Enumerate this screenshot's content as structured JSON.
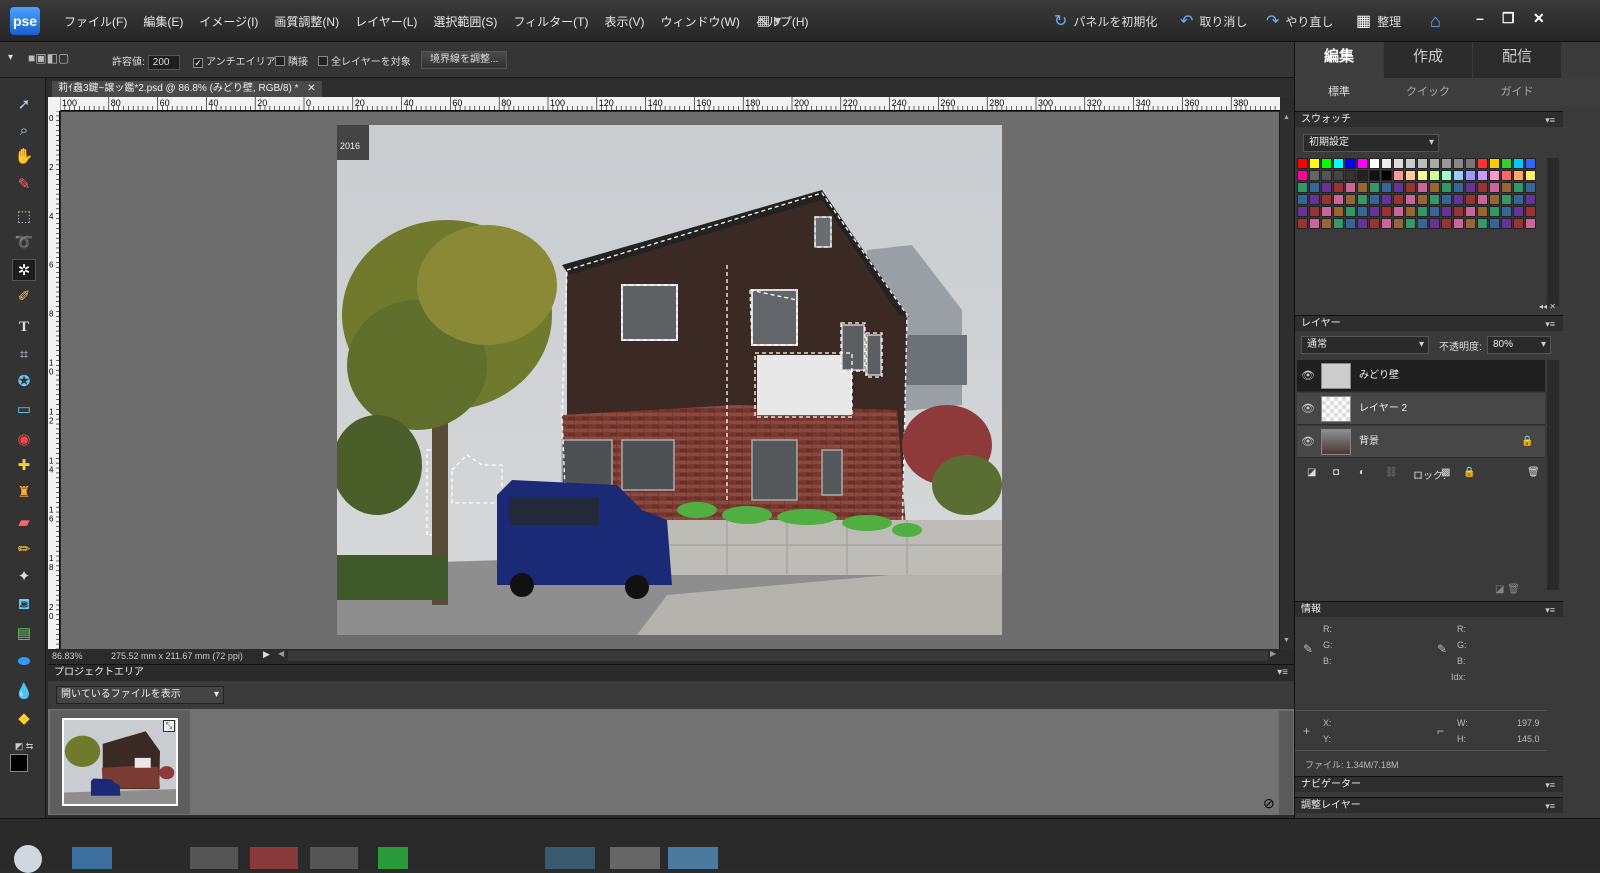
{
  "app": {
    "logo_text": "pse"
  },
  "menu": [
    "ファイル(F)",
    "編集(E)",
    "イメージ(I)",
    "画質調整(N)",
    "レイヤー(L)",
    "選択範囲(S)",
    "フィルター(T)",
    "表示(V)",
    "ウィンドウ(W)",
    "ヘルプ(H)"
  ],
  "topbar": {
    "reset_panels": "パネルを初期化",
    "undo": "取り消し",
    "redo": "やり直し",
    "organize": "整理"
  },
  "options": {
    "tolerance_label": "許容値:",
    "tolerance_value": "200",
    "antialias": "アンチエイリアス",
    "antialias_checked": true,
    "contiguous": "隣接",
    "all_layers": "全レイヤーを対象",
    "refine_edge": "境界線を調整..."
  },
  "document": {
    "tab_title": "莉ｲ蟲3鍵~譲ッ鑑*2.psd @ 86.8% (みどり壁, RGB/8) *",
    "photo_year": "2016",
    "zoom": "86.83%",
    "doc_size": "275.52 mm x 211.67 mm (72 ppi)"
  },
  "ruler_h": [
    "100",
    "80",
    "60",
    "40",
    "20",
    "0",
    "20",
    "40",
    "60",
    "80",
    "100",
    "120",
    "140",
    "160",
    "180",
    "200",
    "220",
    "240",
    "260",
    "280",
    "300",
    "320",
    "340",
    "360",
    "380"
  ],
  "ruler_v": [
    "0",
    "2",
    "4",
    "6",
    "8",
    "1\n0",
    "1\n2",
    "1\n4",
    "1\n6",
    "1\n8",
    "2\n0"
  ],
  "project": {
    "title": "プロジェクトエリア",
    "filter": "開いているファイルを表示"
  },
  "right_panel": {
    "tabs": [
      "編集",
      "作成",
      "配信"
    ],
    "subtabs": [
      "標準",
      "クイック",
      "ガイド"
    ],
    "swatches": {
      "title": "スウォッチ",
      "preset": "初期設定"
    },
    "layers": {
      "title": "レイヤー",
      "blend_mode": "通常",
      "opacity_label": "不透明度:",
      "opacity_value": "80%",
      "lock_label": "ロック:",
      "items": [
        {
          "name": "みどり壁",
          "selected": true
        },
        {
          "name": "レイヤー 2",
          "selected": false
        },
        {
          "name": "背景",
          "selected": false,
          "locked": true
        }
      ]
    },
    "info": {
      "title": "情報",
      "r": "R:",
      "g": "G:",
      "b": "B:",
      "idx": "Idx:",
      "x": "X:",
      "y": "Y:",
      "w": "W:",
      "h": "H:",
      "w_value": "197.9",
      "h_value": "145.0",
      "file": "ファイル: 1.34M/7.18M"
    },
    "navigator": "ナビゲーター",
    "adjustments": "調整レイヤー"
  },
  "swatch_colors": [
    "#ff0000",
    "#ffff00",
    "#00ff00",
    "#00ffff",
    "#0000ff",
    "#ff00ff",
    "#ffffff",
    "#eeeeee",
    "#dddddd",
    "#cccccc",
    "#bbbbbb",
    "#aaaaaa",
    "#999999",
    "#888888",
    "#777777",
    "#ff3333",
    "#ffcc00",
    "#33cc33",
    "#00ccff",
    "#3366ff",
    "#ff0099",
    "#666666",
    "#555555",
    "#444444",
    "#333333",
    "#222222",
    "#111111",
    "#000000",
    "#ff9999",
    "#ffcc99",
    "#ffff99",
    "#ccff99",
    "#99ffcc",
    "#99ccff",
    "#9999ff",
    "#cc99ff",
    "#ff99cc",
    "#ff6666",
    "#ffaa66",
    "#ffee66"
  ],
  "colors": {
    "accent": "#6ab0ff",
    "panel": "#3a3a3a"
  }
}
